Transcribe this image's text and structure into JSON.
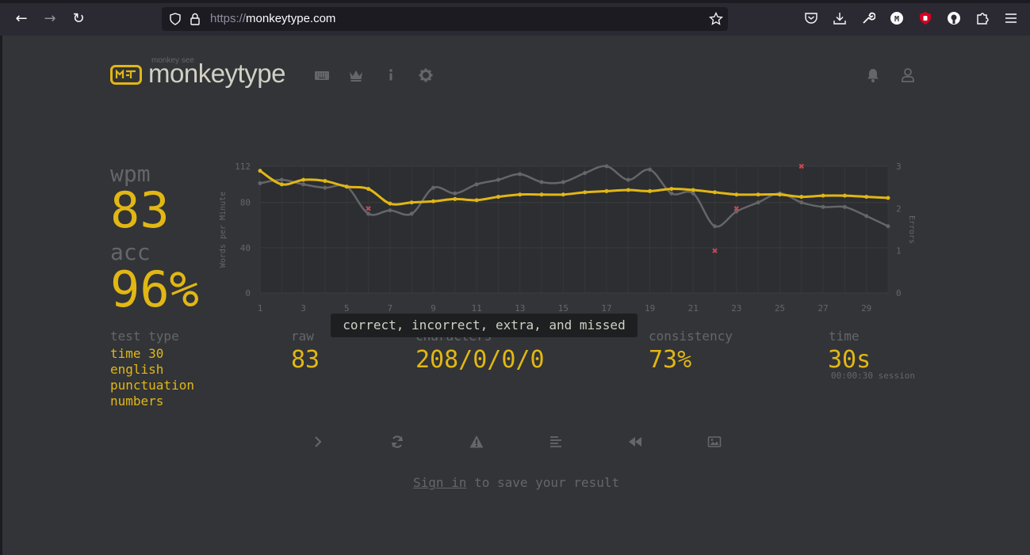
{
  "browser": {
    "url_scheme": "https://",
    "url_host": "monkeytype.com"
  },
  "header": {
    "logo_small": "monkey see",
    "logo_text": "monkeytype"
  },
  "stats": {
    "wpm_label": "wpm",
    "wpm_value": "83",
    "acc_label": "acc",
    "acc_value": "96%",
    "test_type_label": "test type",
    "test_type_values": [
      "time 30",
      "english",
      "punctuation",
      "numbers"
    ],
    "raw_label": "raw",
    "raw_value": "83",
    "characters_label": "characters",
    "characters_value": "208/0/0/0",
    "consistency_label": "consistency",
    "consistency_value": "73%",
    "time_label": "time",
    "time_value": "30s",
    "session": "00:00:30 session"
  },
  "tooltip": "correct, incorrect, extra, and missed",
  "signin": {
    "link": "Sign in",
    "rest": " to save your result"
  },
  "colors": {
    "bg": "#323437",
    "accent": "#e2b714",
    "sub": "#646669",
    "text": "#d1d0c5",
    "error": "#ca4754"
  },
  "chart_data": {
    "type": "line",
    "ylabel": "Words per Minute",
    "y2label": "Errors",
    "ylim": [
      0,
      112
    ],
    "y2lim": [
      0,
      3
    ],
    "yticks": [
      "0",
      "40",
      "80",
      "112"
    ],
    "y2ticks": [
      "0",
      "1",
      "2",
      "3"
    ],
    "xticks": [
      "1",
      "3",
      "5",
      "7",
      "9",
      "11",
      "13",
      "15",
      "17",
      "19",
      "21",
      "23",
      "25",
      "27",
      "29"
    ],
    "x": [
      1,
      2,
      3,
      4,
      5,
      6,
      7,
      8,
      9,
      10,
      11,
      12,
      13,
      14,
      15,
      16,
      17,
      18,
      19,
      20,
      21,
      22,
      23,
      24,
      25,
      26,
      27,
      28,
      29,
      30
    ],
    "series": [
      {
        "name": "wpm",
        "color": "#e2b714",
        "values": [
          108,
          96,
          100,
          99,
          94,
          92,
          79,
          80,
          81,
          83,
          82,
          85,
          87,
          87,
          87,
          89,
          90,
          91,
          90,
          92,
          91,
          89,
          87,
          87,
          87,
          85,
          86,
          86,
          85,
          84
        ]
      },
      {
        "name": "raw",
        "color": "#646669",
        "values": [
          97,
          100,
          96,
          93,
          94,
          70,
          73,
          70,
          93,
          88,
          96,
          100,
          105,
          98,
          98,
          106,
          112,
          100,
          109,
          88,
          88,
          59,
          72,
          80,
          88,
          80,
          76,
          76,
          68,
          59
        ]
      }
    ],
    "errors": [
      {
        "x": 6,
        "y": 2
      },
      {
        "x": 22,
        "y": 1
      },
      {
        "x": 23,
        "y": 2
      },
      {
        "x": 26,
        "y": 3
      }
    ]
  }
}
